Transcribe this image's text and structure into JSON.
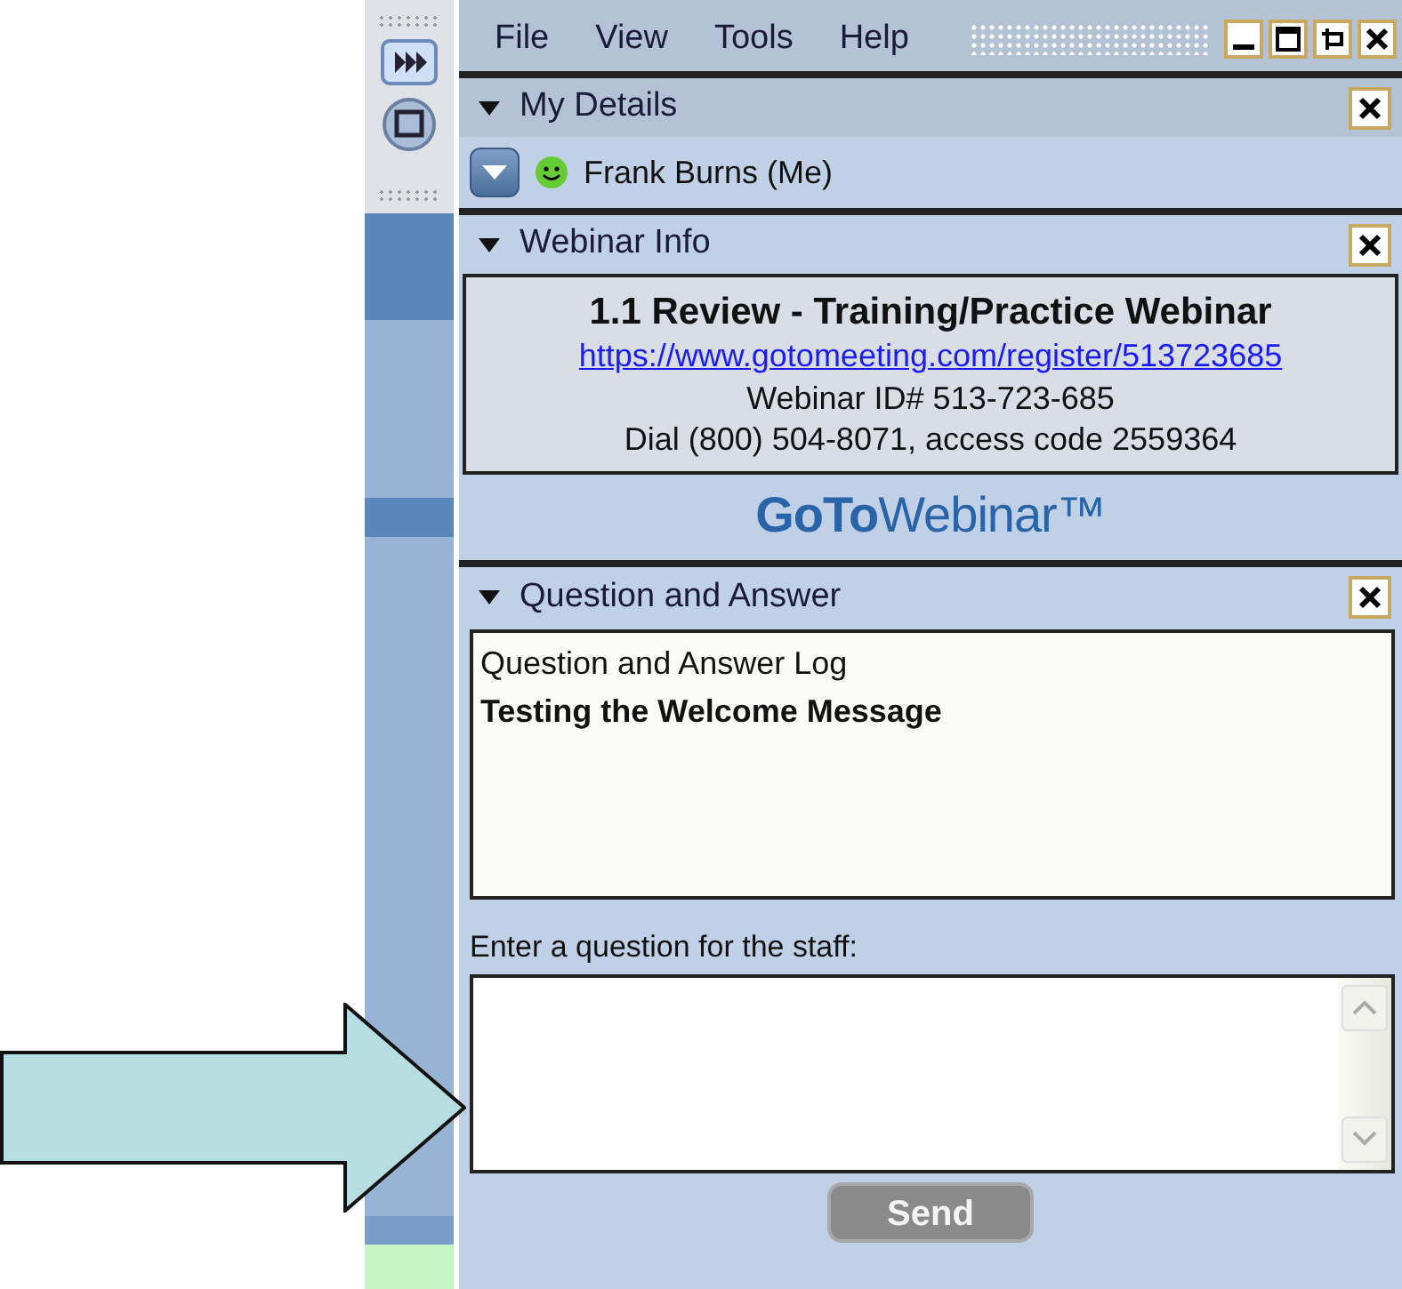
{
  "menu": [
    {
      "label": "File"
    },
    {
      "label": "View"
    },
    {
      "label": "Tools"
    },
    {
      "label": "Help"
    }
  ],
  "my_details": {
    "title": "My Details",
    "expanded": true,
    "attendee": "Frank Burns (Me)"
  },
  "webinar_info": {
    "title": "Webinar Info",
    "expanded": true,
    "name": "1.1 Review - Training/Practice Webinar",
    "link": "https://www.gotomeeting.com/register/513723685",
    "webinar_id": "Webinar ID# 513-723-685",
    "dial": "Dial (800) 504-8071, access code 2559364",
    "logo": "**GoTo**Webinar™"
  },
  "question_and_answer": {
    "title": "Question and Answer",
    "expanded": true,
    "log": [
      {
        "kind": "heading",
        "text": "Question and Answer Log"
      },
      {
        "kind": "message",
        "text": "Testing the Welcome Message"
      }
    ],
    "prompt": "Enter a question for the staff:",
    "send": {
      "label": "Send",
      "disabled": true
    }
  }
}
